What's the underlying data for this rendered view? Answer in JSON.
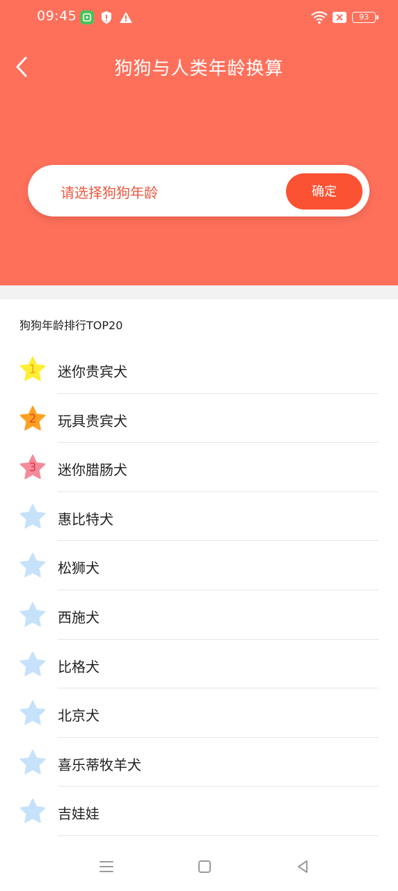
{
  "status_bar": {
    "time": "09:45",
    "battery": "93",
    "icons": [
      "app-notification-icon",
      "shield-icon",
      "warning-icon",
      "wifi-icon",
      "sim-off-icon",
      "battery-icon"
    ]
  },
  "header": {
    "title": "狗狗与人类年龄换算",
    "back_icon": "chevron-left-icon",
    "background_color": "#ff705b"
  },
  "picker": {
    "placeholder": "请选择狗狗年龄",
    "confirm_label": "确定",
    "accent_color": "#fb5233"
  },
  "ranking": {
    "title": "狗狗年龄排行TOP20",
    "items": [
      {
        "rank": "1",
        "name": "迷你贵宾犬",
        "star_color": "#ffee33",
        "num_color": "#e6a817"
      },
      {
        "rank": "2",
        "name": "玩具贵宾犬",
        "star_color": "#ffa020",
        "num_color": "#e0461e"
      },
      {
        "rank": "3",
        "name": "迷你腊肠犬",
        "star_color": "#f48a9a",
        "num_color": "#e0354c"
      },
      {
        "rank": "",
        "name": "惠比特犬",
        "star_color": "#c6e2fb",
        "num_color": ""
      },
      {
        "rank": "",
        "name": "松狮犬",
        "star_color": "#c6e2fb",
        "num_color": ""
      },
      {
        "rank": "",
        "name": "西施犬",
        "star_color": "#c6e2fb",
        "num_color": ""
      },
      {
        "rank": "",
        "name": "比格犬",
        "star_color": "#c6e2fb",
        "num_color": ""
      },
      {
        "rank": "",
        "name": "北京犬",
        "star_color": "#c6e2fb",
        "num_color": ""
      },
      {
        "rank": "",
        "name": "喜乐蒂牧羊犬",
        "star_color": "#c6e2fb",
        "num_color": ""
      },
      {
        "rank": "",
        "name": "吉娃娃",
        "star_color": "#c6e2fb",
        "num_color": ""
      }
    ]
  },
  "nav_bar": {
    "icons": [
      "menu-icon",
      "home-icon",
      "back-triangle-icon"
    ]
  }
}
